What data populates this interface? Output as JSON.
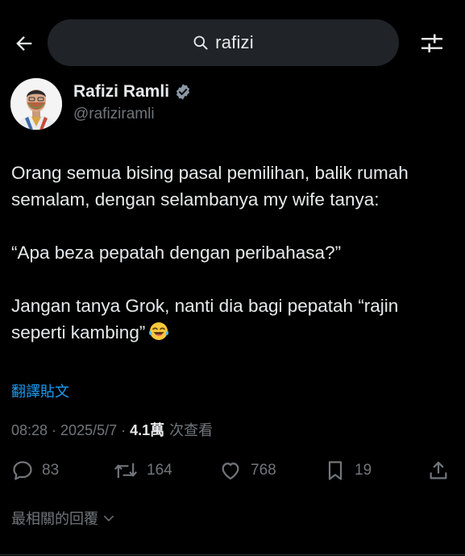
{
  "search": {
    "query": "rafizi"
  },
  "author": {
    "name": "Rafizi Ramli",
    "handle": "@rafiziramli",
    "verified": true
  },
  "post": {
    "paragraphs": [
      "Orang semua bising pasal pemilihan, balik rumah semalam, dengan selambanya my wife tanya:",
      "“Apa beza pepatah dengan peribahasa?”",
      "Jangan tanya Grok, nanti dia bagi pepatah “rajin seperti kambing”"
    ],
    "emoji": "tears-of-joy-emoji"
  },
  "translate_label": "翻譯貼文",
  "meta": {
    "time": "08:28",
    "date": "2025/5/7",
    "views": "4.1萬",
    "views_label": "次查看"
  },
  "actions": {
    "replies": "83",
    "reposts": "164",
    "likes": "768",
    "bookmarks": "19"
  },
  "replies_sort_label": "最相關的回覆",
  "colors": {
    "background": "#000000",
    "text": "#e7e9ea",
    "secondary": "#71767b",
    "accent": "#1d9bf0",
    "search_bg": "#202327"
  }
}
